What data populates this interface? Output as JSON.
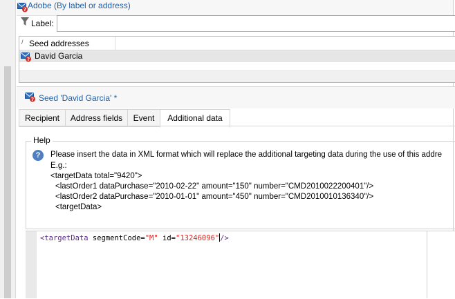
{
  "folder": {
    "title": "Adobe (By label or address)",
    "icon": "envelope-error-icon"
  },
  "filter": {
    "label": "Label:",
    "value": ""
  },
  "seed_list": {
    "column_header": "Seed addresses",
    "rows": [
      {
        "name": "David Garcia",
        "icon": "envelope-error-icon"
      }
    ]
  },
  "editor": {
    "title": "Seed 'David Garcia' *",
    "tabs": [
      {
        "label": "Recipient",
        "active": false
      },
      {
        "label": "Address fields",
        "active": false
      },
      {
        "label": "Event",
        "active": false
      },
      {
        "label": "Additional data",
        "active": true
      }
    ]
  },
  "help": {
    "legend": "Help",
    "icon": "question-icon",
    "lines": [
      "Please insert the data in XML format which will replace the additional targeting data during the use of this addre",
      "E.g.:",
      "<targetData total=\"9420\">",
      "<lastOrder1 dataPurchase=\"2010-02-22\" amount=\"150\" number=\"CMD2010022200401\"/>",
      "<lastOrder2 dataPurchase=\"2010-01-01\" amount=\"450\" number=\"CMD2010010136340\"/>",
      "<targetData>"
    ]
  },
  "xml_editor": {
    "tag_open": "<targetData",
    "attr1": " segmentCode=",
    "val1": "\"M\"",
    "attr2": " id=",
    "val2": "\"13246096\"",
    "tag_close": "/>"
  },
  "colors": {
    "link_blue": "#1f5fa6",
    "xml_tag": "#5b2b8c",
    "xml_value": "#e0201b",
    "selection": "#e6e6e6"
  }
}
